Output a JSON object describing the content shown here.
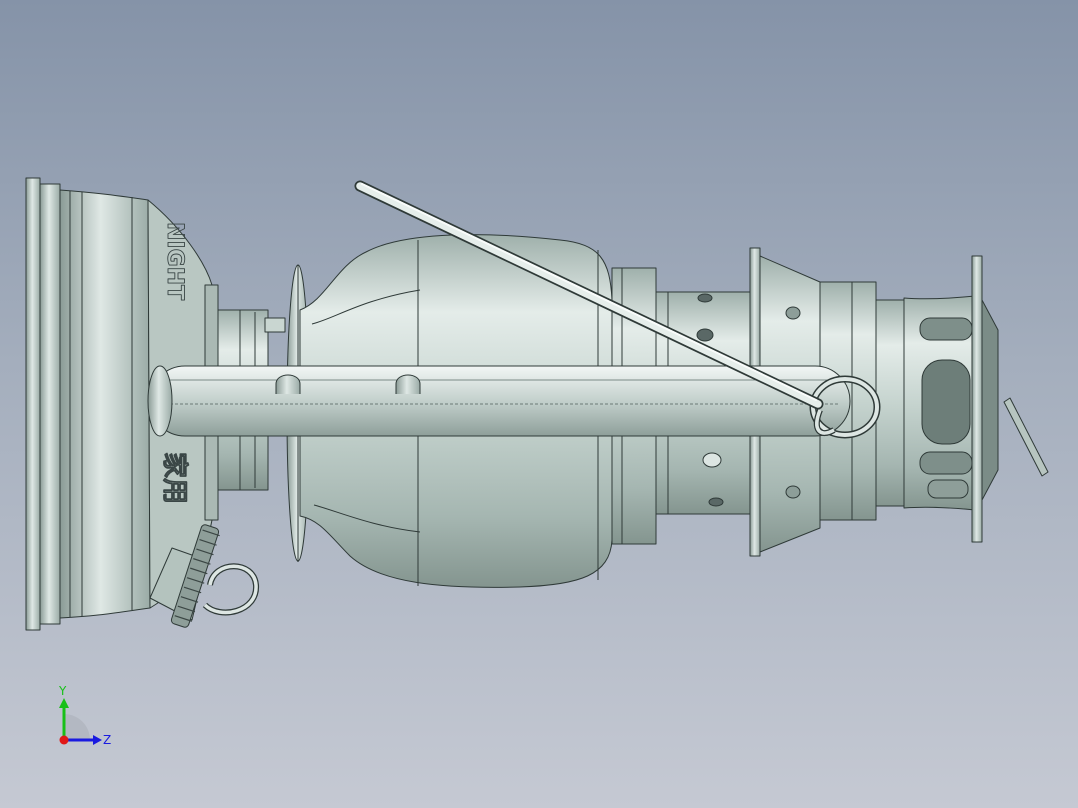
{
  "viewport": {
    "background_top": "#8593a8",
    "background_bottom": "#c5c9d3",
    "model_color": "#c9d6d1",
    "edge_color": "#2f3a38"
  },
  "model": {
    "engraving_latin": "NIGHT",
    "engraving_cjk": "家用"
  },
  "triad": {
    "y_label": "Y",
    "z_label": "Z",
    "y_color": "#18c018",
    "z_color": "#1a1ae0",
    "x_color": "#e01818"
  }
}
